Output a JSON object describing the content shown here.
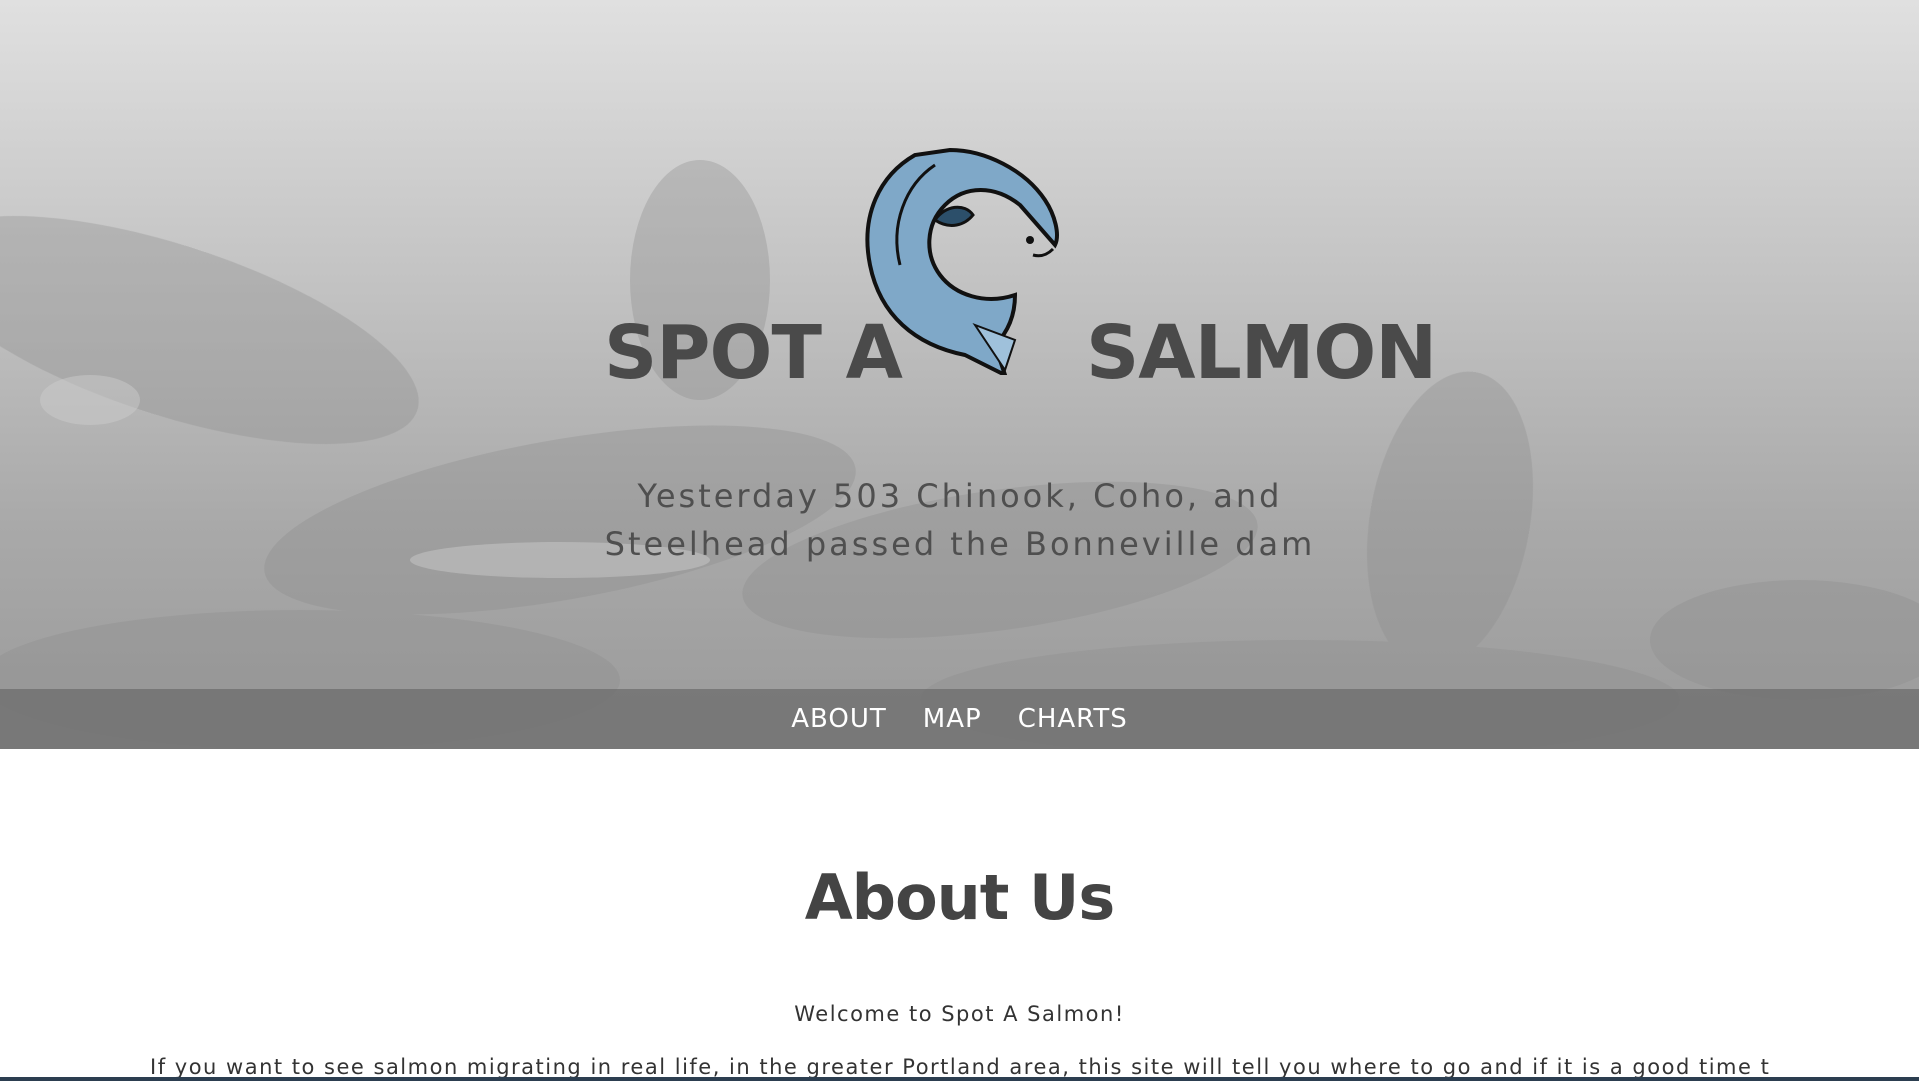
{
  "header": {
    "title_left": "SPOT A",
    "title_right": "SALMON",
    "subtitle_line1": "Yesterday 503 Chinook, Coho, and",
    "subtitle_line2": "Steelhead passed the Bonneville dam",
    "logo_icon": "salmon-logo-icon"
  },
  "nav": {
    "items": [
      {
        "label": "ABOUT"
      },
      {
        "label": "MAP"
      },
      {
        "label": "CHARTS"
      }
    ]
  },
  "main": {
    "heading": "About Us",
    "welcome": "Welcome to Spot A Salmon!",
    "intro": "If you want to see salmon migrating in real life, in the greater Portland area, this site will tell you where to go and if it is a good time to go. The peak"
  },
  "colors": {
    "title": "#4a4a4a",
    "navbar": "#6e6e6e",
    "nav_text": "#ffffff",
    "fish_blue": "#7fa8c8",
    "bottom_bar": "#2c3e50"
  }
}
